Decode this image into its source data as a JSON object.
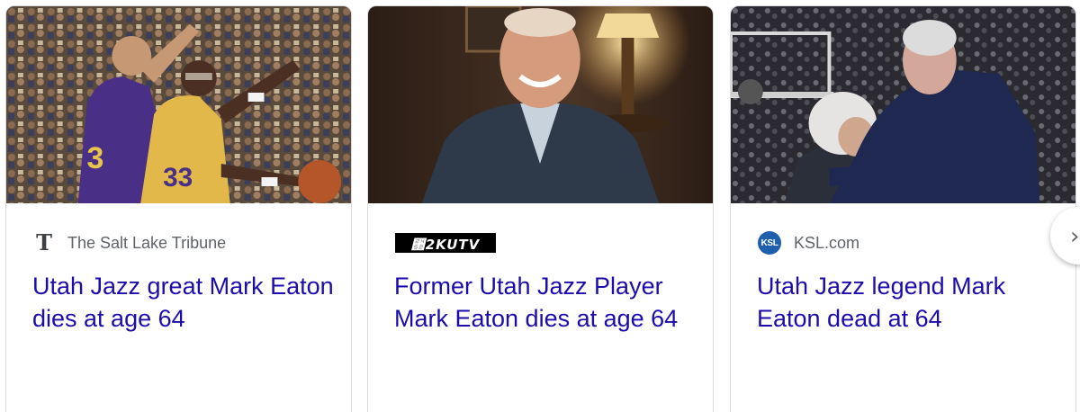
{
  "cards": [
    {
      "source": "The Salt Lake Tribune",
      "source_logo": "T",
      "headline": "Utah Jazz great Mark Eaton dies at age 64"
    },
    {
      "source_logo": "⑒2KUTV",
      "headline": "Former Utah Jazz Player Mark Eaton dies at age 64"
    },
    {
      "source": "KSL.com",
      "source_logo": "KSL",
      "headline": "Utah Jazz legend Mark Eaton dead at 64"
    }
  ],
  "next_button": {
    "icon": "chevron-right-icon",
    "glyph": "›"
  },
  "colors": {
    "headline_link": "#1a0dab",
    "source_text": "#5f6368",
    "card_border": "#dadce0",
    "ksl_brand": "#1f5fae"
  }
}
